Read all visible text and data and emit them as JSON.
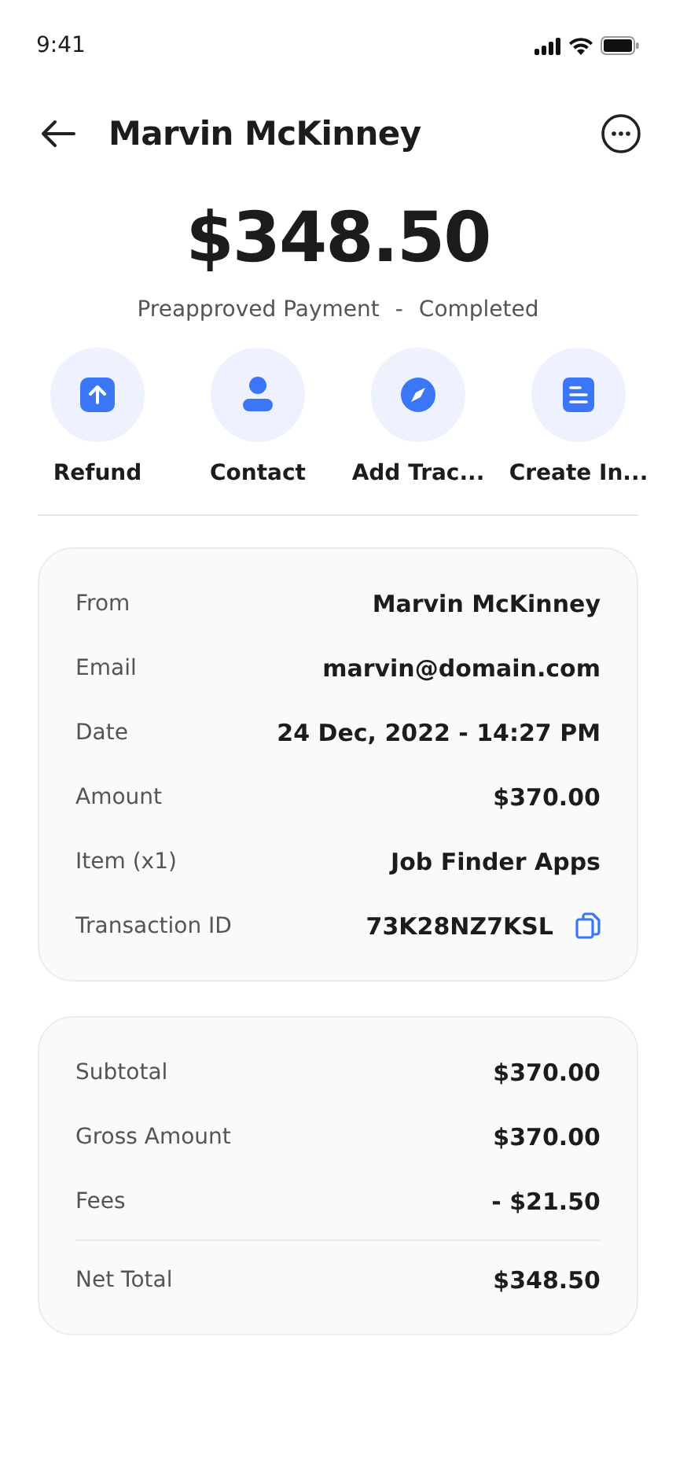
{
  "status_bar": {
    "time": "9:41"
  },
  "header": {
    "title": "Marvin McKinney"
  },
  "amount": "$348.50",
  "subtitle": {
    "type": "Preapproved Payment",
    "separator": "-",
    "status": "Completed"
  },
  "actions": [
    {
      "kind": "refund",
      "label": "Refund"
    },
    {
      "kind": "contact",
      "label": "Contact"
    },
    {
      "kind": "track",
      "label": "Add Trac..."
    },
    {
      "kind": "invoice",
      "label": "Create In..."
    }
  ],
  "details": [
    {
      "label": "From",
      "value": "Marvin McKinney"
    },
    {
      "label": "Email",
      "value": "marvin@domain.com"
    },
    {
      "label": "Date",
      "value": "24 Dec, 2022 - 14:27 PM"
    },
    {
      "label": "Amount",
      "value": "$370.00"
    },
    {
      "label": "Item (x1)",
      "value": "Job Finder Apps"
    },
    {
      "label": "Transaction ID",
      "value": "73K28NZ7KSL",
      "kind": "copyable"
    }
  ],
  "summary": [
    {
      "label": "Subtotal",
      "value": "$370.00"
    },
    {
      "label": "Gross Amount",
      "value": "$370.00"
    },
    {
      "label": "Fees",
      "value": "- $21.50"
    },
    {
      "label": "Net Total",
      "value": "$348.50",
      "kind": "total"
    }
  ]
}
